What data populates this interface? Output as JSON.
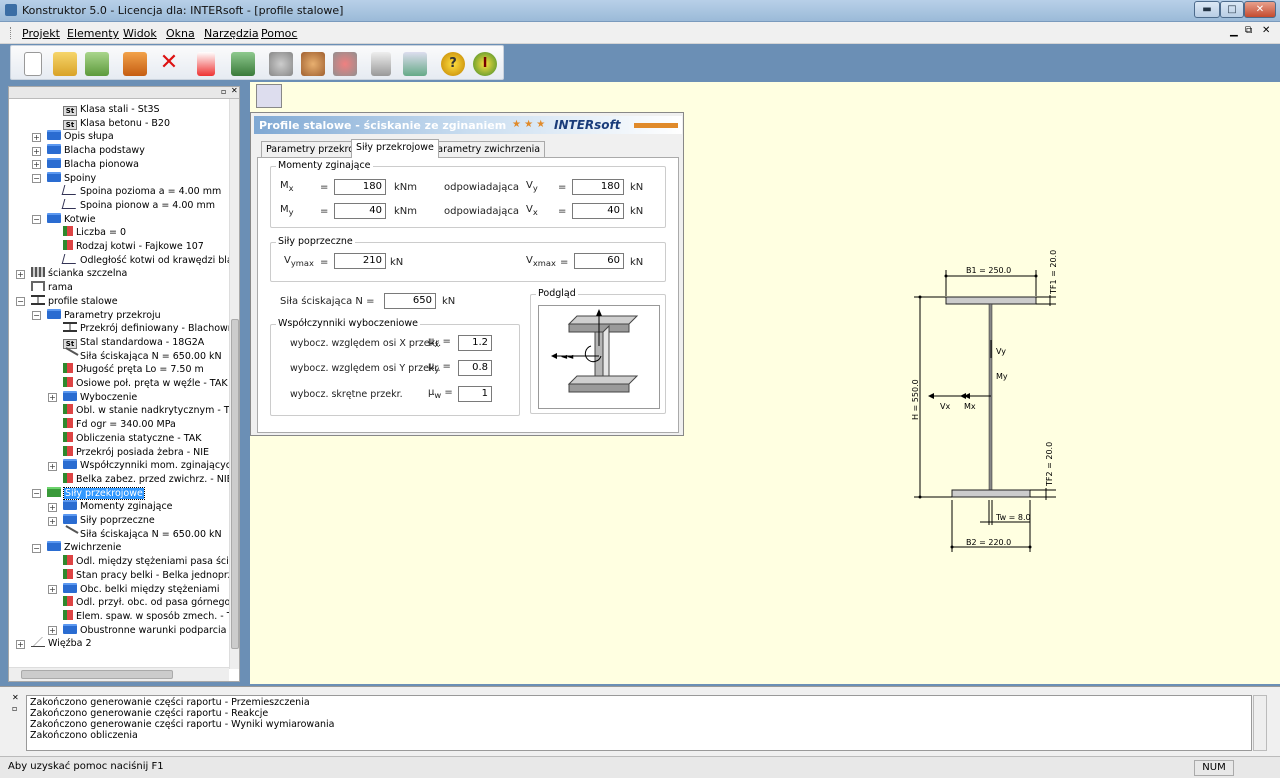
{
  "window": {
    "title": "Konstruktor 5.0 - Licencja dla: INTERsoft - [profile stalowe]",
    "min": "▬",
    "max": "□",
    "close": "✕"
  },
  "menu": {
    "items": [
      "Projekt",
      "Elementy",
      "Widok",
      "Okna",
      "Narzędzia",
      "Pomoc"
    ]
  },
  "tree": {
    "items": [
      {
        "label": "Klasa stali - St3S",
        "indent": 3,
        "icon": "st"
      },
      {
        "label": "Klasa betonu - B20",
        "indent": 3,
        "icon": "st"
      },
      {
        "label": "Opis słupa",
        "indent": 2,
        "icon": "folder",
        "exp": "+"
      },
      {
        "label": "Blacha podstawy",
        "indent": 2,
        "icon": "folder",
        "exp": "+"
      },
      {
        "label": "Blacha pionowa",
        "indent": 2,
        "icon": "folder",
        "exp": "+"
      },
      {
        "label": "Spoiny",
        "indent": 2,
        "icon": "folder",
        "exp": "-"
      },
      {
        "label": "Spoina pozioma a = 4.00 mm",
        "indent": 3,
        "icon": "weld"
      },
      {
        "label": "Spoina pionow a = 4.00 mm",
        "indent": 3,
        "icon": "weld"
      },
      {
        "label": "Kotwie",
        "indent": 2,
        "icon": "folder",
        "exp": "-"
      },
      {
        "label": "Liczba = 0",
        "indent": 3,
        "icon": "param"
      },
      {
        "label": "Rodzaj kotwi - Fajkowe 107",
        "indent": 3,
        "icon": "param"
      },
      {
        "label": "Odległość kotwi od krawędzi blachy",
        "indent": 3,
        "icon": "weld"
      },
      {
        "label": "ścianka szczelna",
        "indent": 1,
        "icon": "wall",
        "exp": "+"
      },
      {
        "label": "rama",
        "indent": 1,
        "icon": "frame"
      },
      {
        "label": "profile stalowe",
        "indent": 1,
        "icon": "profile",
        "exp": "-"
      },
      {
        "label": "Parametry przekroju",
        "indent": 2,
        "icon": "folder",
        "exp": "-"
      },
      {
        "label": "Przekrój definiowany - Blachownica",
        "indent": 3,
        "icon": "ibeam"
      },
      {
        "label": "Stal standardowa - 18G2A",
        "indent": 3,
        "icon": "st"
      },
      {
        "label": "Siła ściskająca N = 650.00 kN",
        "indent": 3,
        "icon": "force"
      },
      {
        "label": "Długość pręta Lo = 7.50 m",
        "indent": 3,
        "icon": "param"
      },
      {
        "label": "Osiowe poł. pręta w węźle - TAK",
        "indent": 3,
        "icon": "param"
      },
      {
        "label": "Wyboczenie",
        "indent": 3,
        "icon": "folder",
        "exp": "+"
      },
      {
        "label": "Obl. w stanie nadkrytycznym - TAK",
        "indent": 3,
        "icon": "param"
      },
      {
        "label": "Fd ogr = 340.00 MPa",
        "indent": 3,
        "icon": "param"
      },
      {
        "label": "Obliczenia statyczne - TAK",
        "indent": 3,
        "icon": "param"
      },
      {
        "label": "Przekrój posiada żebra - NIE",
        "indent": 3,
        "icon": "param"
      },
      {
        "label": "Współczynniki mom. zginających",
        "indent": 3,
        "icon": "folder",
        "exp": "+"
      },
      {
        "label": "Belka zabez. przed zwichrz. - NIE",
        "indent": 3,
        "icon": "param"
      },
      {
        "label": "Siły przekrojowe",
        "indent": 2,
        "icon": "green",
        "exp": "-",
        "selected": true
      },
      {
        "label": "Momenty zginające",
        "indent": 3,
        "icon": "folder",
        "exp": "+"
      },
      {
        "label": "Siły poprzeczne",
        "indent": 3,
        "icon": "folder",
        "exp": "+"
      },
      {
        "label": "Siła ściskająca N = 650.00 kN",
        "indent": 3,
        "icon": "force"
      },
      {
        "label": "Zwichrzenie",
        "indent": 2,
        "icon": "folder",
        "exp": "-"
      },
      {
        "label": "Odl. między stężeniami pasa ścisk. =",
        "indent": 3,
        "icon": "param"
      },
      {
        "label": "Stan pracy belki - Belka jednoprzęsł",
        "indent": 3,
        "icon": "param"
      },
      {
        "label": "Obc. belki między stężeniami",
        "indent": 3,
        "icon": "folder",
        "exp": "+"
      },
      {
        "label": "Odl. przył. obc. od pasa górnego =",
        "indent": 3,
        "icon": "param"
      },
      {
        "label": "Elem. spaw. w sposób zmech. - TAK",
        "indent": 3,
        "icon": "param"
      },
      {
        "label": "Obustronne warunki podparcia",
        "indent": 3,
        "icon": "folder",
        "exp": "+"
      },
      {
        "label": "Więźba 2",
        "indent": 1,
        "icon": "truss",
        "exp": "+"
      }
    ]
  },
  "dialog": {
    "title": "Profile stalowe - ściskanie ze zginaniem",
    "brand": "INTERsoft",
    "tabs": [
      "Parametry przekroju",
      "Siły przekrojowe",
      "Parametry zwichrzenia"
    ],
    "moments": {
      "group": "Momenty zginające",
      "mx_label": "M",
      "mx_sub": "x",
      "mx": "180",
      "mx_unit": "kNm",
      "my_label": "M",
      "my_sub": "y",
      "my": "40",
      "my_unit": "kNm",
      "corr": "odpowiadająca",
      "vy_label": "V",
      "vy_sub": "y",
      "vy": "180",
      "vy_unit": "kN",
      "vx_label": "V",
      "vx_sub": "x",
      "vx": "40",
      "vx_unit": "kN",
      "eq": "="
    },
    "shear": {
      "group": "Siły poprzeczne",
      "vymax_label": "V",
      "vymax_sub": "ymax",
      "vymax": "210",
      "vymax_unit": "kN",
      "vxmax_label": "V",
      "vxmax_sub": "xmax",
      "vxmax": "60",
      "vxmax_unit": "kN"
    },
    "axial": {
      "label": "Siła ściskająca N =",
      "value": "650",
      "unit": "kN"
    },
    "buckling": {
      "group": "Współczynniki wyboczeniowe",
      "x_label": "wybocz. względem osi X przekr.",
      "x_sym": "μ",
      "x_sub": "x",
      "x_val": "1.2",
      "y_label": "wybocz. względem osi Y przekr.",
      "y_sym": "μ",
      "y_sub": "y",
      "y_val": "0.8",
      "w_label": "wybocz. skrętne przekr.",
      "w_sym": "μ",
      "w_sub": "w",
      "w_val": "1"
    },
    "preview": {
      "group": "Podgląd"
    }
  },
  "drawing": {
    "b1": "B1 = 250.0",
    "tf1": "TF1 = 20.0",
    "h": "H = 550.0",
    "tf2": "TF2 = 20.0",
    "tw": "Tw = 8.0",
    "b2": "B2 = 220.0",
    "vy": "Vy",
    "my": "My",
    "vx": "Vx",
    "mx": "Mx"
  },
  "log": {
    "lines": [
      "Zakończono generowanie części raportu - Przemieszczenia",
      "Zakończono generowanie części raportu - Reakcje",
      "Zakończono generowanie części raportu - Wyniki wymiarowania",
      "Zakończono obliczenia"
    ]
  },
  "status": {
    "help": "Aby uzyskać pomoc naciśnij F1",
    "num": "NUM"
  }
}
